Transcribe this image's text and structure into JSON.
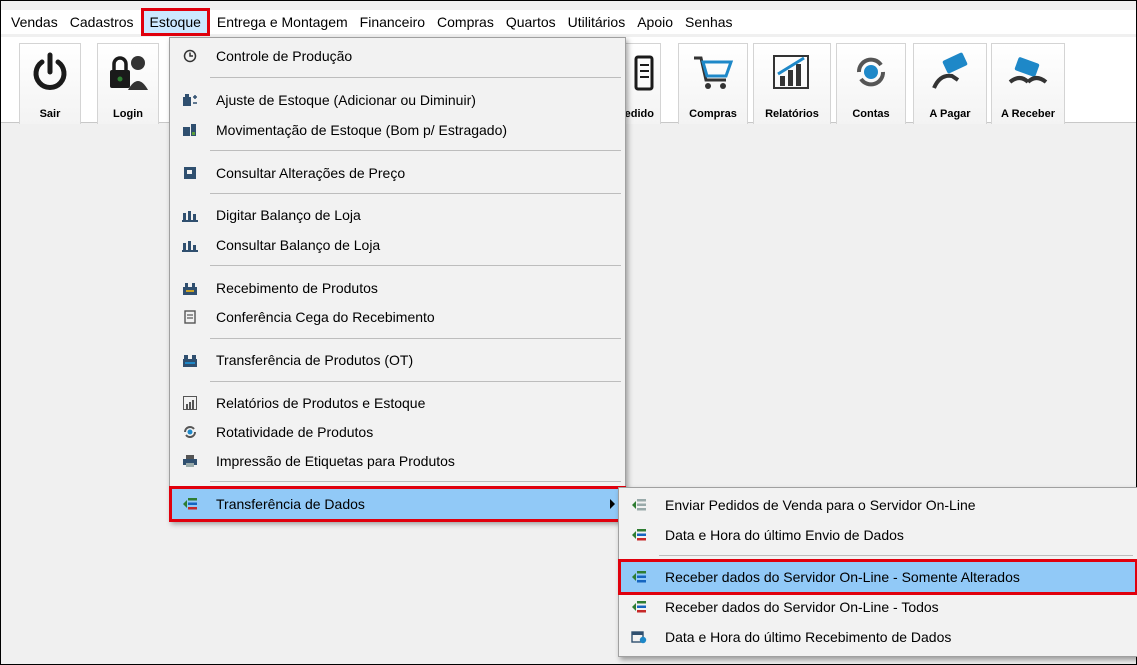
{
  "menubar": {
    "items": [
      "Vendas",
      "Cadastros",
      "Estoque",
      "Entrega e Montagem",
      "Financeiro",
      "Compras",
      "Quartos",
      "Utilitários",
      "Apoio",
      "Senhas"
    ]
  },
  "toolbar": {
    "left_buttons": [
      {
        "label": "Sair",
        "icon": "power-icon"
      },
      {
        "label": "Login",
        "icon": "user-lock-icon"
      }
    ],
    "partial_label": "edido",
    "right_buttons": [
      {
        "label": "Compras",
        "icon": "cart-icon"
      },
      {
        "label": "Relatórios",
        "icon": "bar-chart-icon"
      },
      {
        "label": "Contas",
        "icon": "refresh-coin-icon"
      },
      {
        "label": "A Pagar",
        "icon": "pay-money-icon"
      },
      {
        "label": "A Receber",
        "icon": "receive-money-icon"
      }
    ]
  },
  "estoque_menu": {
    "items": [
      {
        "label": "Controle de Produção",
        "icon": "clock-icon"
      },
      {
        "label": "Ajuste de Estoque  (Adicionar ou Diminuir)",
        "icon": "stock-adjust-icon"
      },
      {
        "label": "Movimentação de Estoque (Bom p/ Estragado)",
        "icon": "stock-move-icon"
      },
      {
        "label": "Consultar Alterações de Preço",
        "icon": "price-icon"
      },
      {
        "label": "Digitar Balanço de Loja",
        "icon": "balance-icon"
      },
      {
        "label": "Consultar Balanço de Loja",
        "icon": "balance-search-icon"
      },
      {
        "label": "Recebimento de Produtos",
        "icon": "warehouse-icon"
      },
      {
        "label": "Conferência Cega do Recebimento",
        "icon": "checklist-icon"
      },
      {
        "label": "Transferência de Produtos (OT)",
        "icon": "transfer-icon"
      },
      {
        "label": "Relatórios de Produtos e Estoque",
        "icon": "report-icon"
      },
      {
        "label": "Rotatividade de Produtos",
        "icon": "rotate-icon"
      },
      {
        "label": "Impressão de Etiquetas para Produtos",
        "icon": "printer-icon"
      },
      {
        "label": "Transferência de Dados",
        "icon": "data-transfer-icon"
      }
    ]
  },
  "transfer_submenu": {
    "items": [
      {
        "label": "Enviar Pedidos de Venda para o Servidor On-Line",
        "icon": "send-data-icon"
      },
      {
        "label": "Data e Hora do último Envio de Dados",
        "icon": "data-transfer-icon"
      },
      {
        "label": "Receber dados do Servidor On-Line - Somente Alterados",
        "icon": "receive-data-icon"
      },
      {
        "label": "Receber dados do Servidor On-Line - Todos",
        "icon": "data-transfer-icon"
      },
      {
        "label": "Data e Hora do último Recebimento de Dados",
        "icon": "calendar-clock-icon"
      }
    ]
  },
  "colors": {
    "highlight": "#91c9f7",
    "callout_red": "#e0000d",
    "menu_bg": "#f2f2f2"
  }
}
